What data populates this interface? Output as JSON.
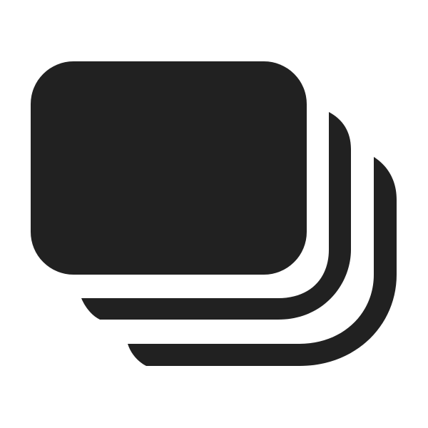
{
  "icon": {
    "name": "stacked-cards-icon",
    "color": "#212121",
    "background": "#ffffff"
  }
}
